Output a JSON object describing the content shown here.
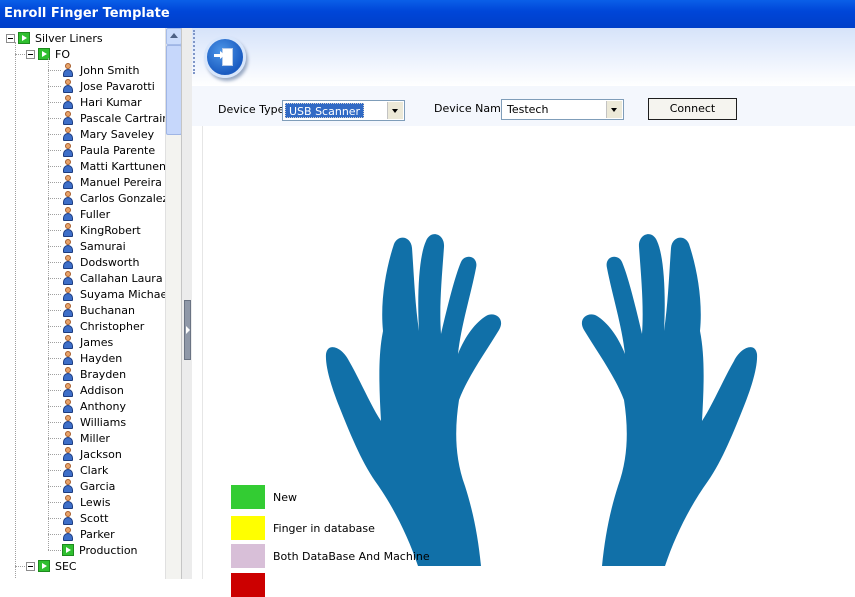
{
  "window": {
    "title": "Enroll Finger Template"
  },
  "tree": {
    "root": "Silver Liners",
    "groups": [
      {
        "label": "FO",
        "users": [
          "John Smith",
          "Jose Pavarotti",
          "Hari Kumar",
          "Pascale Cartrain",
          "Mary Saveley",
          "Paula Parente",
          "Matti Karttunen",
          "Manuel Pereira",
          "Carlos Gonzalez",
          "Fuller",
          "KingRobert",
          "Samurai",
          "Dodsworth",
          "Callahan Laura",
          "Suyama Michael",
          "Buchanan",
          "Christopher",
          "James",
          "Hayden",
          "Brayden",
          "Addison",
          "Anthony",
          "Williams",
          "Miller",
          "Jackson",
          "Clark",
          "Garcia",
          "Lewis",
          "Scott",
          "Parker"
        ],
        "subfolder": "Production"
      },
      {
        "label": "SEC"
      }
    ]
  },
  "toolbar": {
    "exit_icon": "exit-door-icon"
  },
  "device": {
    "type_label": "Device Type",
    "type_value": "USB Scanner",
    "name_label": "Device Name",
    "name_value": "Testech",
    "connect_label": "Connect"
  },
  "legend": [
    {
      "label": "New",
      "color": "#33cc33"
    },
    {
      "label": "Finger in database",
      "color": "#ffff00"
    },
    {
      "label": "Both DataBase And Machine",
      "color": "#d8bfd8"
    },
    {
      "label": "",
      "color": "#cc0000"
    }
  ],
  "colors": {
    "hand": "#1170a8",
    "titlebar": "#0046d8"
  }
}
